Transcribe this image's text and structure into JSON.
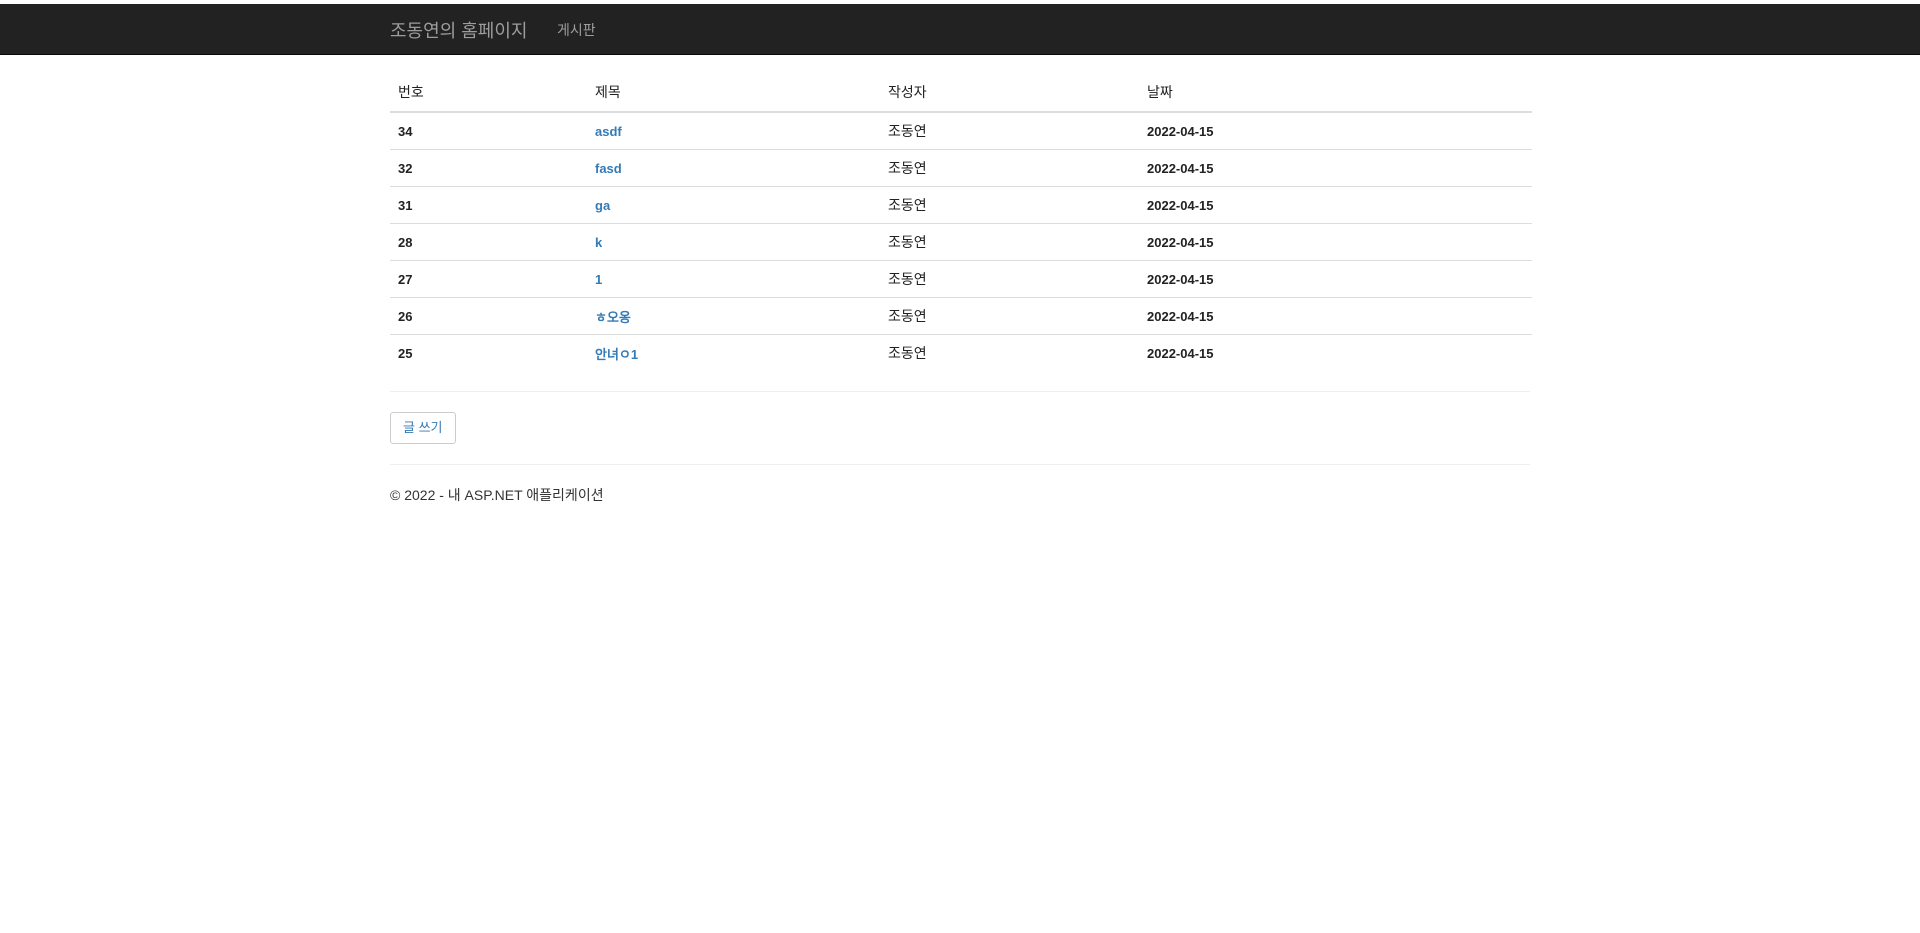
{
  "navbar": {
    "brand": "조동연의 홈페이지",
    "links": [
      "게시판"
    ]
  },
  "table": {
    "headers": [
      "번호",
      "제목",
      "작성자",
      "날짜"
    ],
    "rows": [
      {
        "no": "34",
        "title": "asdf",
        "author": "조동연",
        "date": "2022-04-15"
      },
      {
        "no": "32",
        "title": "fasd",
        "author": "조동연",
        "date": "2022-04-15"
      },
      {
        "no": "31",
        "title": "ga",
        "author": "조동연",
        "date": "2022-04-15"
      },
      {
        "no": "28",
        "title": "k",
        "author": "조동연",
        "date": "2022-04-15"
      },
      {
        "no": "27",
        "title": "1",
        "author": "조동연",
        "date": "2022-04-15"
      },
      {
        "no": "26",
        "title": "ㅎ오옹",
        "author": "조동연",
        "date": "2022-04-15"
      },
      {
        "no": "25",
        "title": "안녀ㅇ1",
        "author": "조동연",
        "date": "2022-04-15"
      }
    ]
  },
  "actions": {
    "write_label": "글 쓰기"
  },
  "footer": {
    "text": "© 2022 - 내 ASP.NET 애플리케이션"
  },
  "colors": {
    "navbar_bg": "#222222",
    "nav_text": "#9d9d9d",
    "link": "#337ab7"
  }
}
